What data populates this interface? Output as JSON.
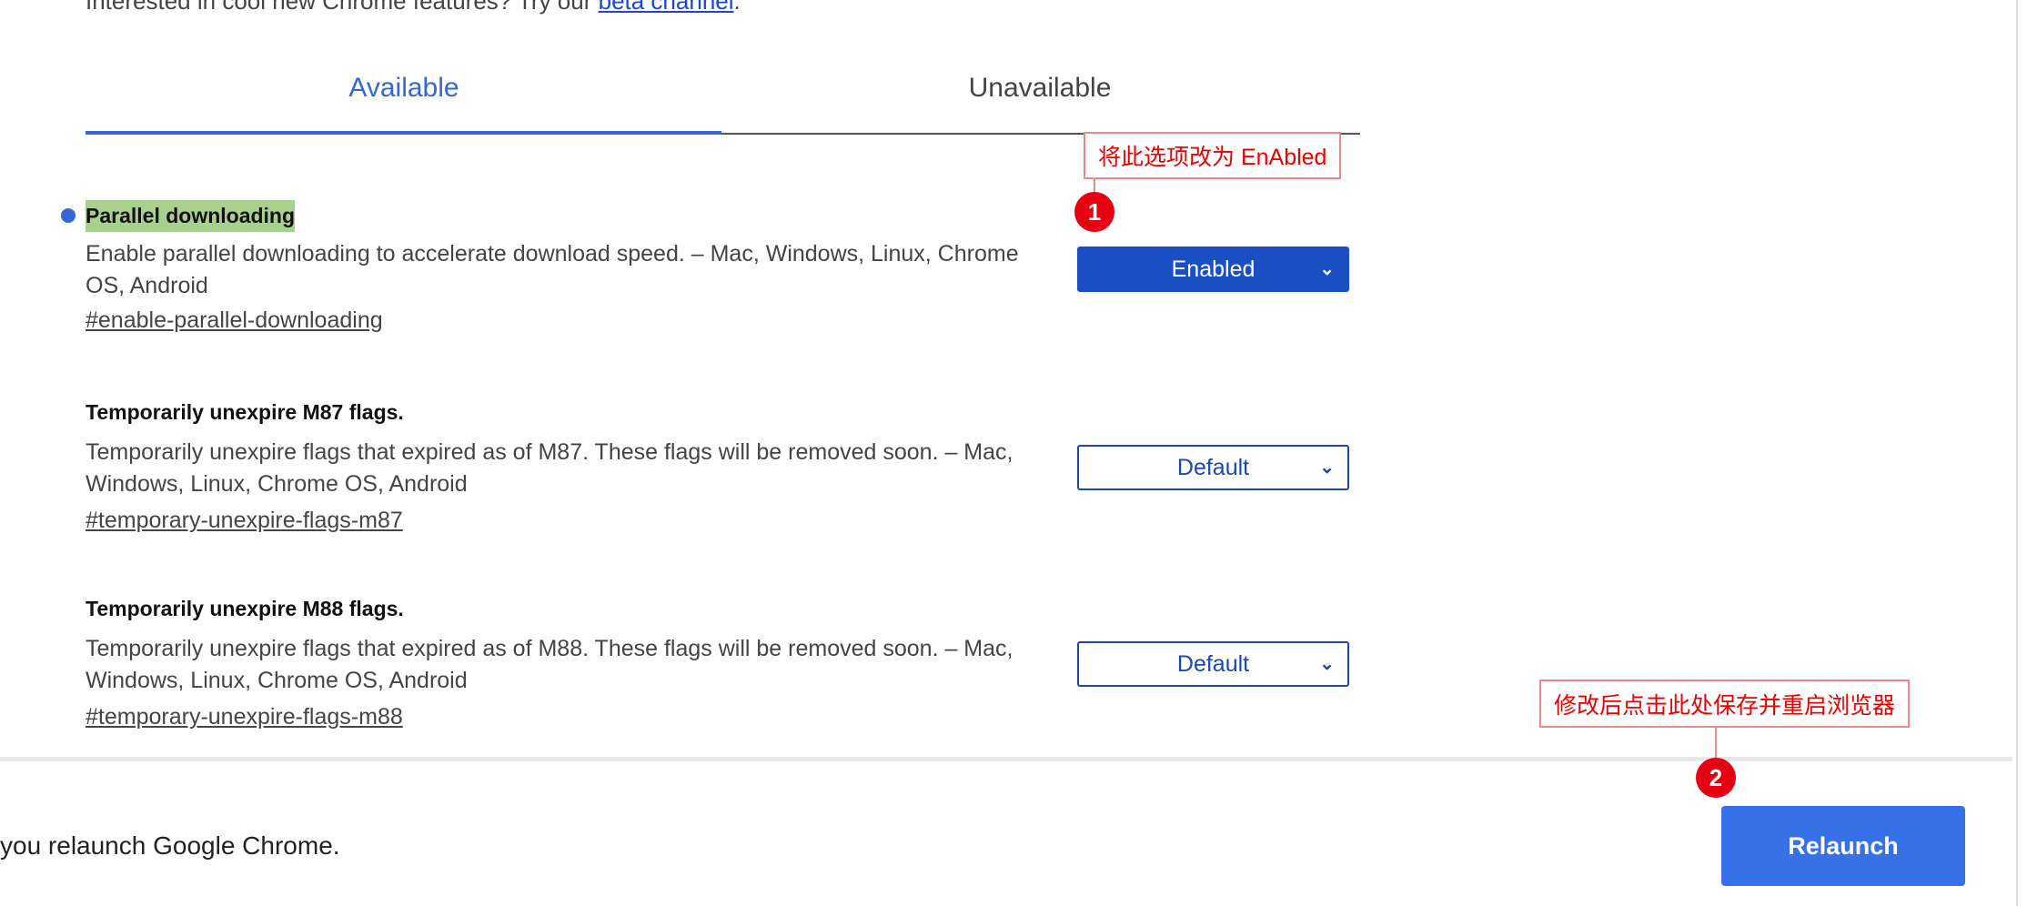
{
  "intro": {
    "text": "Interested in cool new Chrome features? Try our ",
    "link": "beta channel",
    "end": "."
  },
  "tabs": [
    {
      "label": "Available",
      "active": true
    },
    {
      "label": "Unavailable",
      "active": false
    }
  ],
  "flags": [
    {
      "title": "Parallel downloading",
      "description": "Enable parallel downloading to accelerate download speed. – Mac, Windows, Linux, Chrome OS, Android",
      "link": "#enable-parallel-downloading",
      "value": "Enabled",
      "highlighted": true
    },
    {
      "title": "Temporarily unexpire M87 flags.",
      "description": "Temporarily unexpire flags that expired as of M87. These flags will be removed soon. – Mac, Windows, Linux, Chrome OS, Android",
      "link": "#temporary-unexpire-flags-m87",
      "value": "Default"
    },
    {
      "title": "Temporarily unexpire M88 flags.",
      "description": "Temporarily unexpire flags that expired as of M88. These flags will be removed soon. – Mac, Windows, Linux, Chrome OS, Android",
      "link": "#temporary-unexpire-flags-m88",
      "value": "Default"
    }
  ],
  "annotations": [
    {
      "number": "1",
      "text": "将此选项改为 EnAbled"
    },
    {
      "number": "2",
      "text": "修改后点击此处保存并重启浏览器"
    }
  ],
  "footer": {
    "message": "you relaunch Google Chrome.",
    "relaunch_label": "Relaunch"
  },
  "colors": {
    "accent": "#3367d6",
    "relaunch": "#3771e8",
    "highlight": "#a9d18e",
    "annotation": "#e60012"
  }
}
